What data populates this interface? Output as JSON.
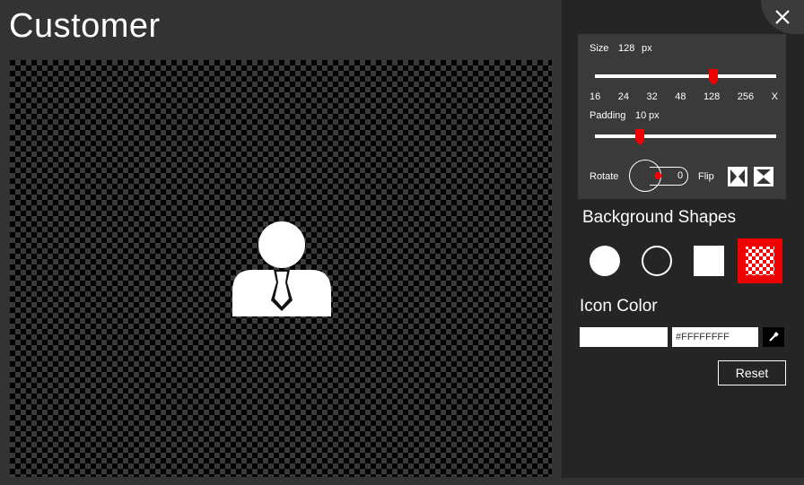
{
  "window": {
    "title": "Customer"
  },
  "preview": {
    "icon": "customer-person-icon",
    "background": "checkerboard-transparent"
  },
  "settings": {
    "size_label": "Size",
    "size_value": "128",
    "size_unit": "px",
    "size_ticks": [
      "16",
      "24",
      "32",
      "48",
      "128",
      "256",
      "X"
    ],
    "size_selected_index": 4,
    "padding_label": "Padding",
    "padding_value": "10",
    "padding_unit": "px",
    "rotate_label": "Rotate",
    "rotate_value": "0",
    "flip_label": "Flip"
  },
  "background_shapes": {
    "title": "Background Shapes",
    "options": [
      "filled-circle",
      "outline-circle",
      "filled-square",
      "transparent"
    ],
    "selected": "transparent"
  },
  "icon_color": {
    "title": "Icon Color",
    "value": "#FFFFFFFF",
    "swatch": "#FFFFFF"
  },
  "buttons": {
    "reset": "Reset"
  },
  "colors": {
    "accent": "#E00000",
    "background": "#333333",
    "panel": "#252525"
  }
}
